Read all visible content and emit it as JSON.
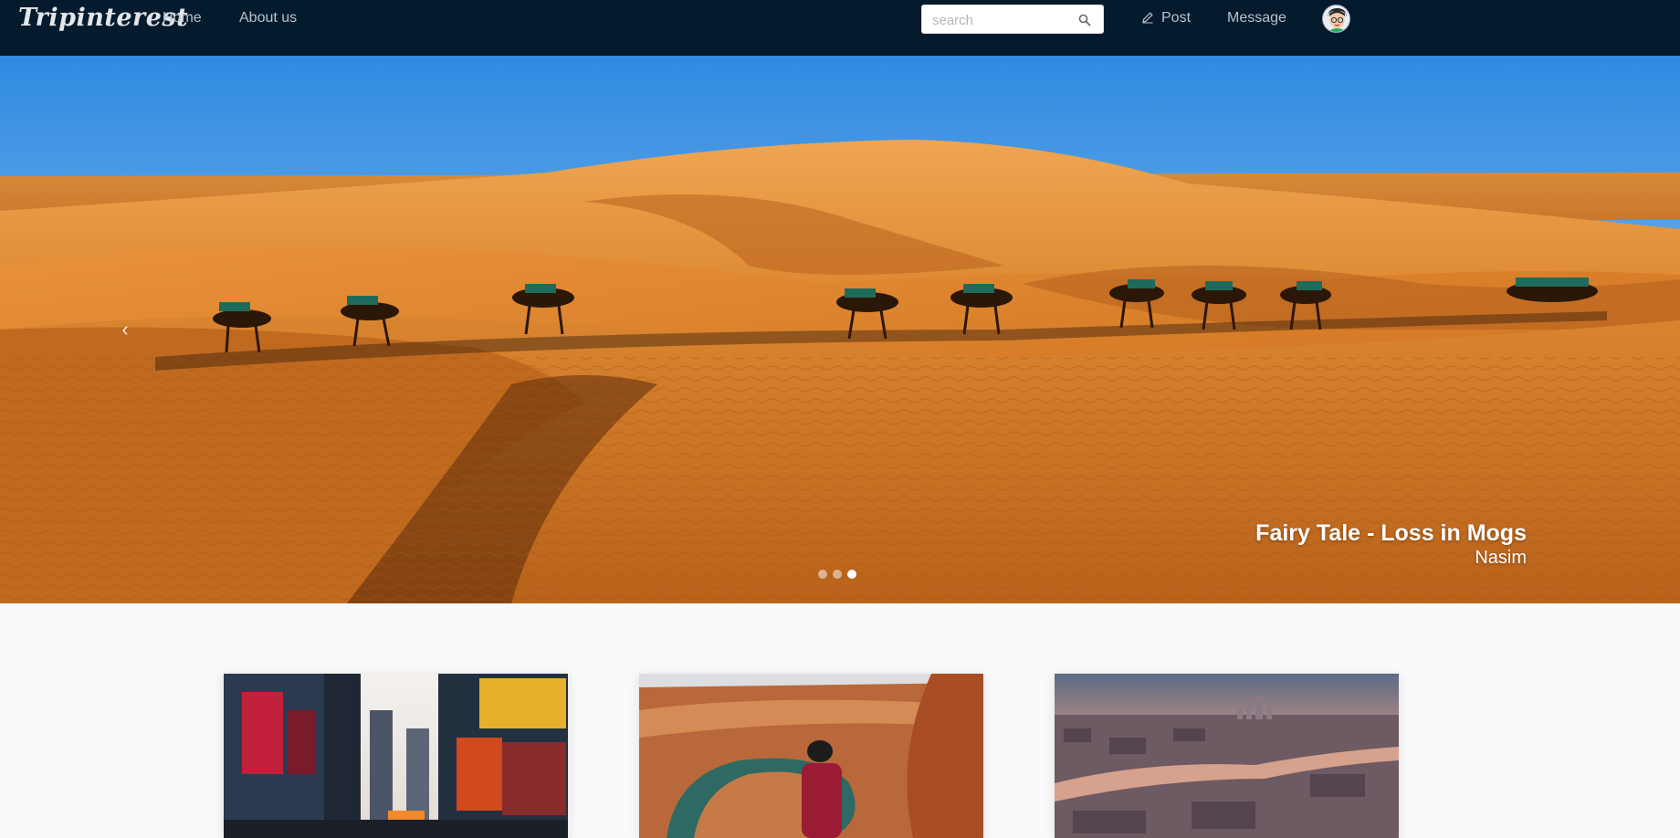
{
  "navbar": {
    "brand": "Tripinterest",
    "links": {
      "home": "Home",
      "about": "About us",
      "post": "Post",
      "message": "Message"
    },
    "search": {
      "placeholder": "search",
      "value": ""
    }
  },
  "hero": {
    "caption_title": "Fairy Tale - Loss in Mogs",
    "caption_author": "Nasim",
    "prev_icon": "chevron-left-icon",
    "slide_count": 3,
    "active_slide": 3
  },
  "cards": [
    {
      "scene": "city-street-billboards"
    },
    {
      "scene": "canyon-river-bend"
    },
    {
      "scene": "city-river-sunset-aerial"
    }
  ],
  "colors": {
    "navbar_bg": "#041b2d",
    "nav_text": "#b9c2cc",
    "sky": "#3d97e6",
    "sand": "#e08a2a",
    "page_bg": "#fafafa"
  }
}
